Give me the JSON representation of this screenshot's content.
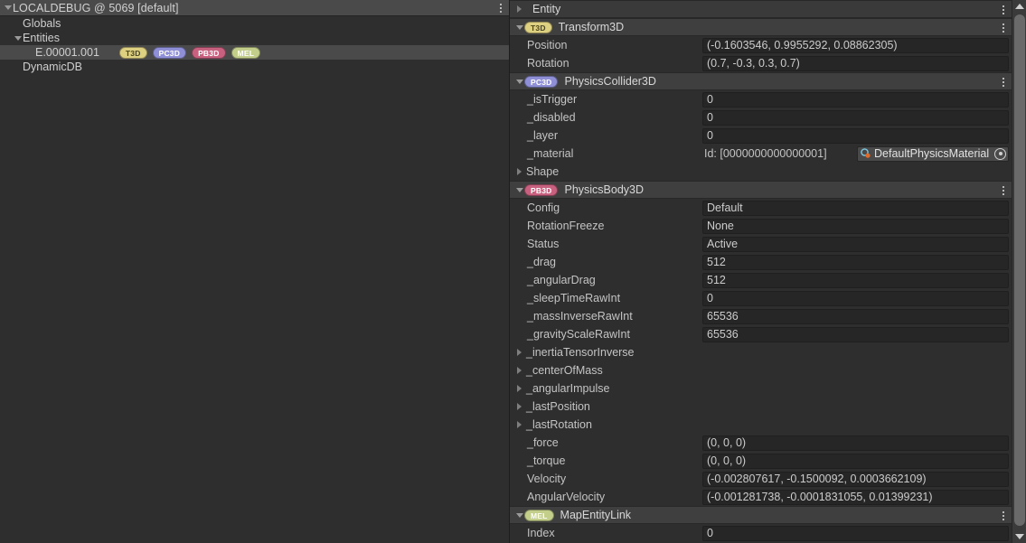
{
  "window": {
    "title": "LOCALDEBUG @ 5069 [default]"
  },
  "colors": {
    "bg": "#2e2e2e",
    "header_bar": "#4a4a4a",
    "comp_header": "#3f3f3f",
    "field_bg": "#262626",
    "selection": "#4a4a4a",
    "text": "#c8c8c8",
    "badge_t3d": "#ded081",
    "badge_pc3d": "#8f8fd8",
    "badge_pb3d": "#c8607f",
    "badge_mel": "#c2ce8a"
  },
  "hierarchy": {
    "menu_icon": "vertical-dots-icon",
    "items": [
      {
        "label": "Globals",
        "indent": 1,
        "caret": "blank",
        "selected": false,
        "badges": []
      },
      {
        "label": "Entities",
        "indent": 1,
        "caret": "down",
        "selected": false,
        "badges": []
      },
      {
        "label": "E.00001.001",
        "indent": 2,
        "caret": "blank",
        "selected": true,
        "badges": [
          {
            "text": "T3D",
            "kind": "t3d"
          },
          {
            "text": "PC3D",
            "kind": "pc3d"
          },
          {
            "text": "PB3D",
            "kind": "pb3d"
          },
          {
            "text": "MEL",
            "kind": "mel"
          }
        ]
      },
      {
        "label": "DynamicDB",
        "indent": 1,
        "caret": "blank",
        "selected": false,
        "badges": []
      }
    ]
  },
  "inspector": {
    "menu_icon": "vertical-dots-icon",
    "sections": [
      {
        "title": "Entity",
        "badge": null,
        "caret": "right",
        "rows": []
      },
      {
        "title": "Transform3D",
        "badge": {
          "text": "T3D",
          "kind": "t3d"
        },
        "caret": "down",
        "rows": [
          {
            "name": "Position",
            "value": "(-0.1603546, 0.9955292, 0.08862305)",
            "type": "field"
          },
          {
            "name": "Rotation",
            "value": "(0.7, -0.3, 0.3, 0.7)",
            "type": "field"
          }
        ]
      },
      {
        "title": "PhysicsCollider3D",
        "badge": {
          "text": "PC3D",
          "kind": "pc3d"
        },
        "caret": "down",
        "rows": [
          {
            "name": "_isTrigger",
            "value": "0",
            "type": "field"
          },
          {
            "name": "_disabled",
            "value": "0",
            "type": "field"
          },
          {
            "name": "_layer",
            "value": "0",
            "type": "field"
          },
          {
            "name": "_material",
            "type": "objref",
            "id_text": "Id: [0000000000000001]",
            "object_name": "DefaultPhysicsMaterial",
            "object_icon": "physics-material-icon",
            "picker_icon": "target-select-icon"
          },
          {
            "name": "Shape",
            "type": "foldout",
            "caret": "right"
          }
        ]
      },
      {
        "title": "PhysicsBody3D",
        "badge": {
          "text": "PB3D",
          "kind": "pb3d"
        },
        "caret": "down",
        "rows": [
          {
            "name": "Config",
            "value": "Default",
            "type": "field"
          },
          {
            "name": "RotationFreeze",
            "value": "None",
            "type": "field"
          },
          {
            "name": "Status",
            "value": "Active",
            "type": "field"
          },
          {
            "name": "_drag",
            "value": "512",
            "type": "field"
          },
          {
            "name": "_angularDrag",
            "value": "512",
            "type": "field"
          },
          {
            "name": "_sleepTimeRawInt",
            "value": "0",
            "type": "field"
          },
          {
            "name": "_massInverseRawInt",
            "value": "65536",
            "type": "field"
          },
          {
            "name": "_gravityScaleRawInt",
            "value": "65536",
            "type": "field"
          },
          {
            "name": "_inertiaTensorInverse",
            "type": "foldout",
            "caret": "right"
          },
          {
            "name": "_centerOfMass",
            "type": "foldout",
            "caret": "right"
          },
          {
            "name": "_angularImpulse",
            "type": "foldout",
            "caret": "right"
          },
          {
            "name": "_lastPosition",
            "type": "foldout",
            "caret": "right"
          },
          {
            "name": "_lastRotation",
            "type": "foldout",
            "caret": "right"
          },
          {
            "name": "_force",
            "value": "(0, 0, 0)",
            "type": "field"
          },
          {
            "name": "_torque",
            "value": "(0, 0, 0)",
            "type": "field"
          },
          {
            "name": "Velocity",
            "value": "(-0.002807617, -0.1500092, 0.0003662109)",
            "type": "field"
          },
          {
            "name": "AngularVelocity",
            "value": "(-0.001281738, -0.0001831055, 0.01399231)",
            "type": "field"
          }
        ]
      },
      {
        "title": "MapEntityLink",
        "badge": {
          "text": "MEL",
          "kind": "mel"
        },
        "caret": "down",
        "rows": [
          {
            "name": "Index",
            "value": "0",
            "type": "field"
          }
        ]
      }
    ]
  },
  "scrollbar": {
    "up_icon": "triangle-up-icon",
    "down_icon": "triangle-down-icon",
    "thumb": "scroll-thumb"
  }
}
